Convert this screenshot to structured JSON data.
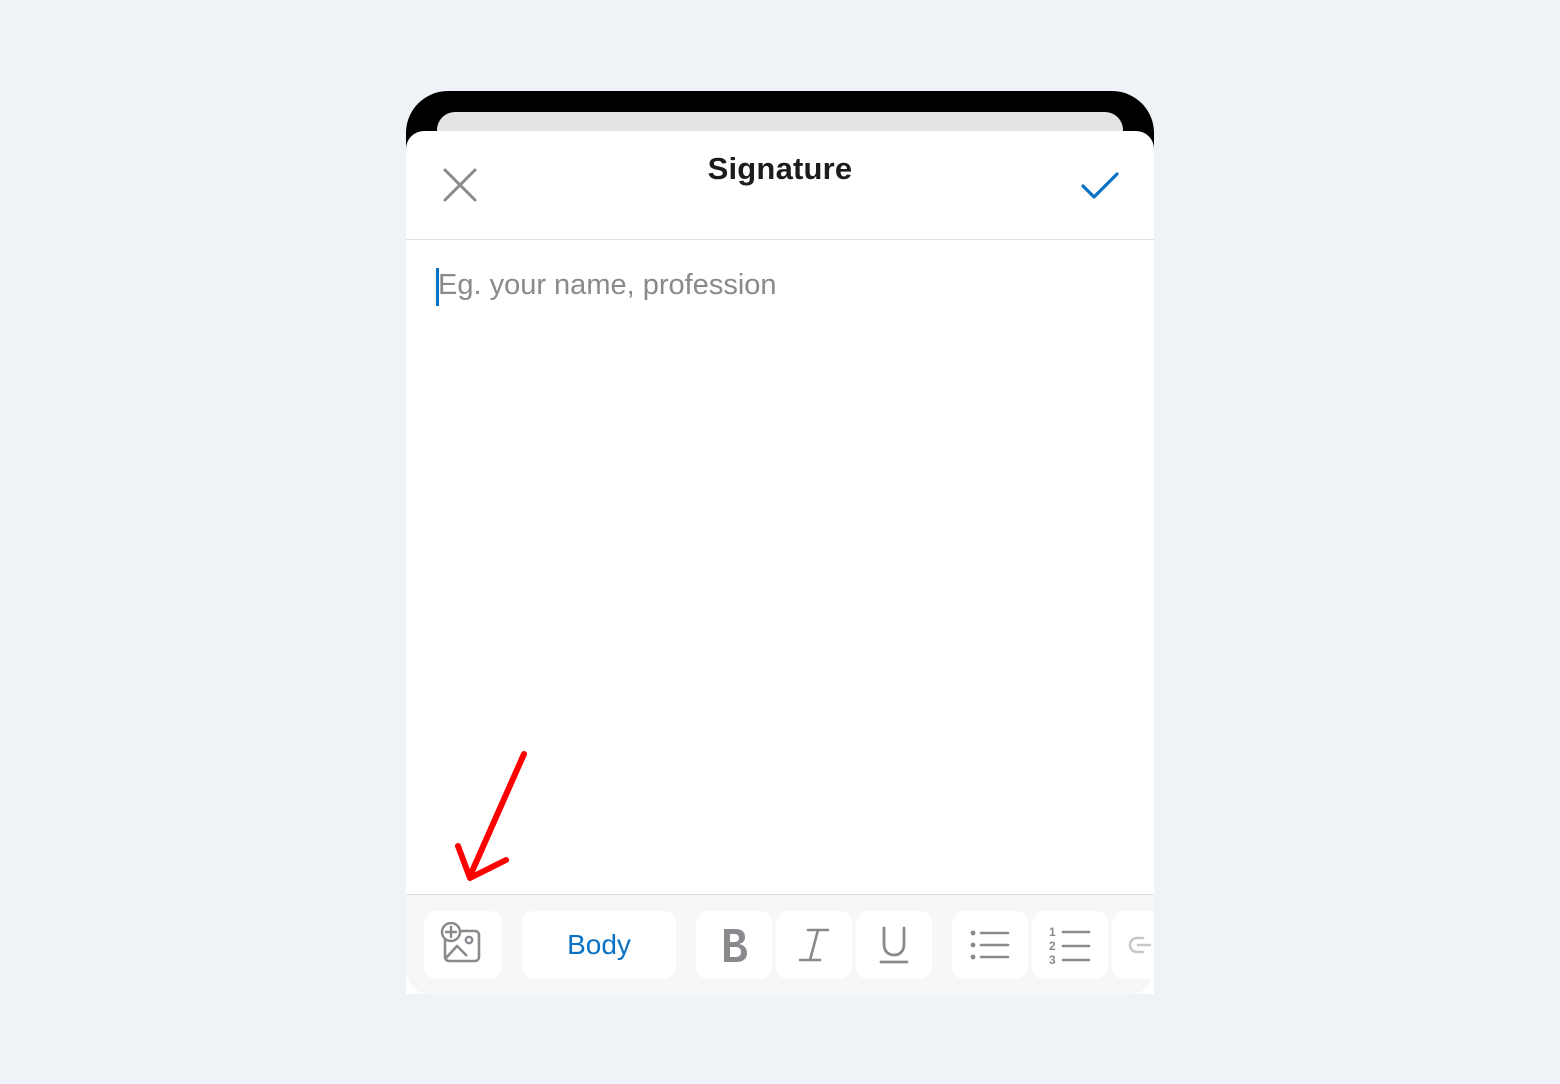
{
  "sheet": {
    "title": "Signature",
    "close_icon": "close-icon",
    "confirm_icon": "checkmark-icon"
  },
  "editor": {
    "placeholder": "Eg. your name, profession"
  },
  "toolbar": {
    "insert_image_icon": "insert-image-icon",
    "style_label": "Body",
    "bold_icon": "bold-icon",
    "italic_icon": "italic-icon",
    "underline_icon": "underline-icon",
    "bullet_list_icon": "bulleted-list-icon",
    "numbered_list_icon": "numbered-list-icon",
    "link_icon": "link-icon"
  },
  "annotation": {
    "arrow": "red-arrow",
    "color": "#ff0000"
  },
  "colors": {
    "accent": "#0a72c4",
    "icon_gray": "#8a8a8e",
    "background": "#eff3f8"
  }
}
